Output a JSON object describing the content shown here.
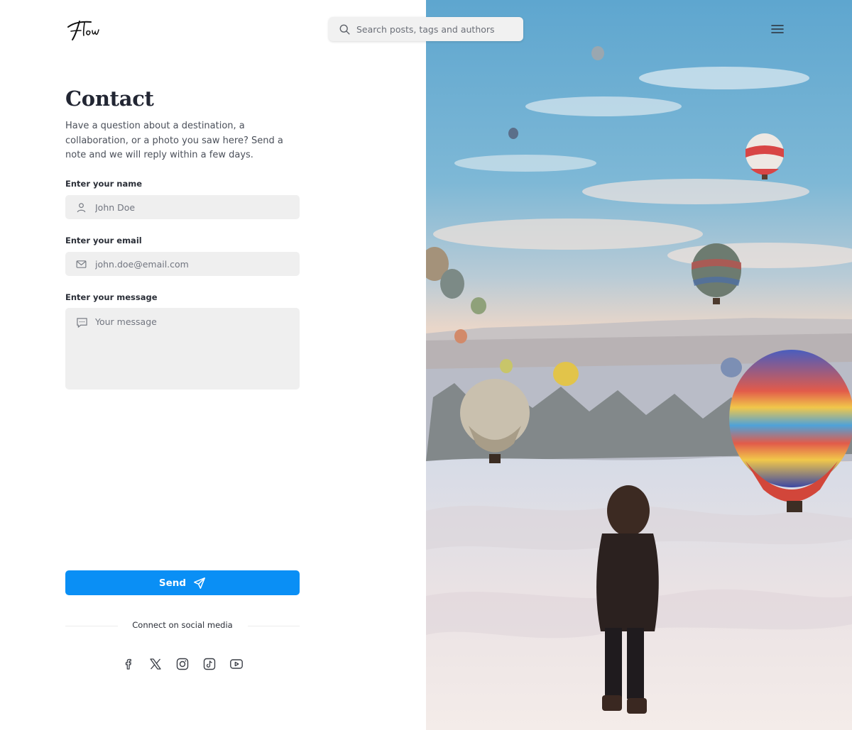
{
  "brand": {
    "logo_text": "Flow"
  },
  "search": {
    "placeholder": "Search posts, tags and authors"
  },
  "contact": {
    "title": "Contact",
    "intro": "Have a question about a destination, a collaboration, or a photo you saw here? Send a note and we will reply within a few days."
  },
  "form": {
    "name": {
      "label": "Enter your name",
      "placeholder": "John Doe",
      "icon": "user-icon"
    },
    "email": {
      "label": "Enter your email",
      "placeholder": "john.doe@email.com",
      "icon": "mail-icon"
    },
    "message": {
      "label": "Enter your message",
      "placeholder": "Your message",
      "icon": "message-icon"
    },
    "send_label": "Send",
    "send_icon": "paper-plane-icon",
    "accent_color": "#0a8ff5"
  },
  "social": {
    "label": "Connect on social media",
    "icons": [
      "facebook-icon",
      "x-icon",
      "instagram-icon",
      "tiktok-icon",
      "youtube-icon"
    ]
  },
  "header": {
    "menu_icon": "hamburger-menu-icon"
  },
  "hero": {
    "image": "hot-air-balloons-snowy-landscape"
  }
}
